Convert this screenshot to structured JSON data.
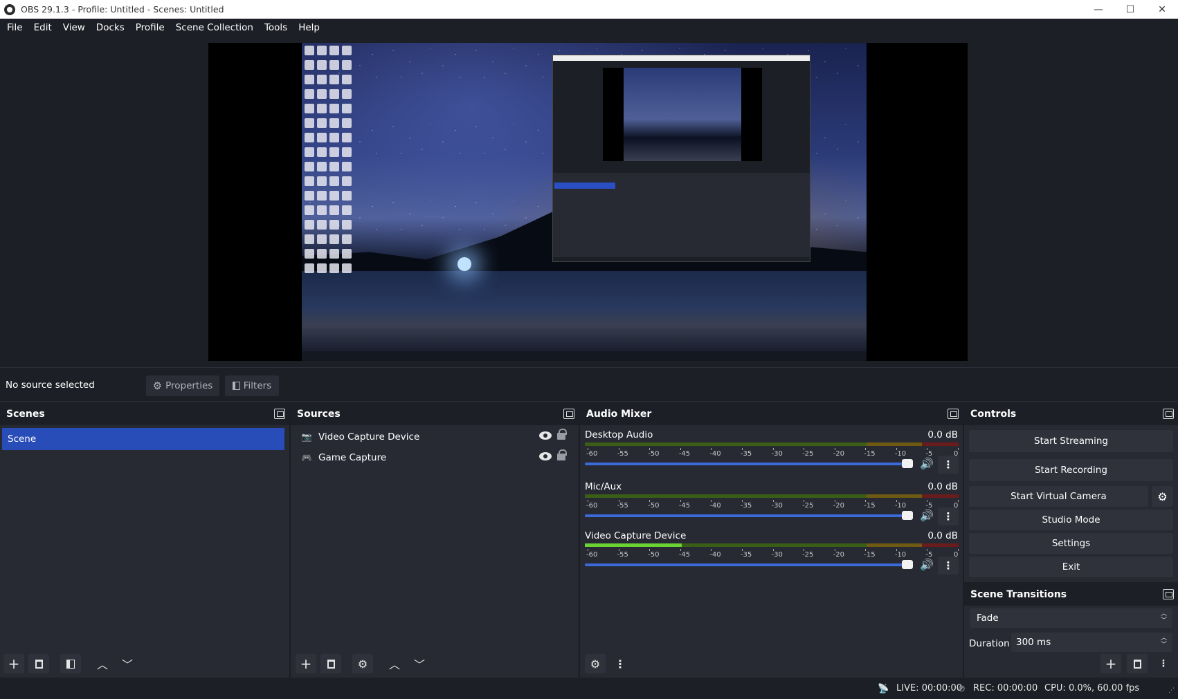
{
  "window": {
    "title": "OBS 29.1.3 - Profile: Untitled - Scenes: Untitled",
    "minimize": "—",
    "maximize": "☐",
    "close": "✕"
  },
  "menu": [
    "File",
    "Edit",
    "View",
    "Docks",
    "Profile",
    "Scene Collection",
    "Tools",
    "Help"
  ],
  "source_toolbar": {
    "status": "No source selected",
    "properties_label": "Properties",
    "filters_label": "Filters"
  },
  "scenes": {
    "title": "Scenes",
    "items": [
      "Scene"
    ],
    "selected_index": 0
  },
  "sources": {
    "title": "Sources",
    "items": [
      {
        "name": "Video Capture Device",
        "icon": "camera-icon"
      },
      {
        "name": "Game Capture",
        "icon": "gamepad-icon"
      }
    ]
  },
  "audio_mixer": {
    "title": "Audio Mixer",
    "scale": [
      "-60",
      "-55",
      "-50",
      "-45",
      "-40",
      "-35",
      "-30",
      "-25",
      "-20",
      "-15",
      "-10",
      "-5",
      "0"
    ],
    "channels": [
      {
        "name": "Desktop Audio",
        "db": "0.0 dB",
        "level": 0.0
      },
      {
        "name": "Mic/Aux",
        "db": "0.0 dB",
        "level": 0.0
      },
      {
        "name": "Video Capture Device",
        "db": "0.0 dB",
        "level": 0.26
      }
    ]
  },
  "controls": {
    "title": "Controls",
    "start_streaming": "Start Streaming",
    "start_recording": "Start Recording",
    "start_virtual_camera": "Start Virtual Camera",
    "studio_mode": "Studio Mode",
    "settings": "Settings",
    "exit": "Exit"
  },
  "scene_transitions": {
    "title": "Scene Transitions",
    "transition": "Fade",
    "duration_label": "Duration",
    "duration_value": "300 ms"
  },
  "status": {
    "live": "LIVE: 00:00:00",
    "rec": "REC: 00:00:00",
    "cpu": "CPU: 0.0%, 60.00 fps"
  },
  "colors": {
    "accent": "#284cb8",
    "background": "#1d1f26",
    "panel": "#272a33"
  }
}
